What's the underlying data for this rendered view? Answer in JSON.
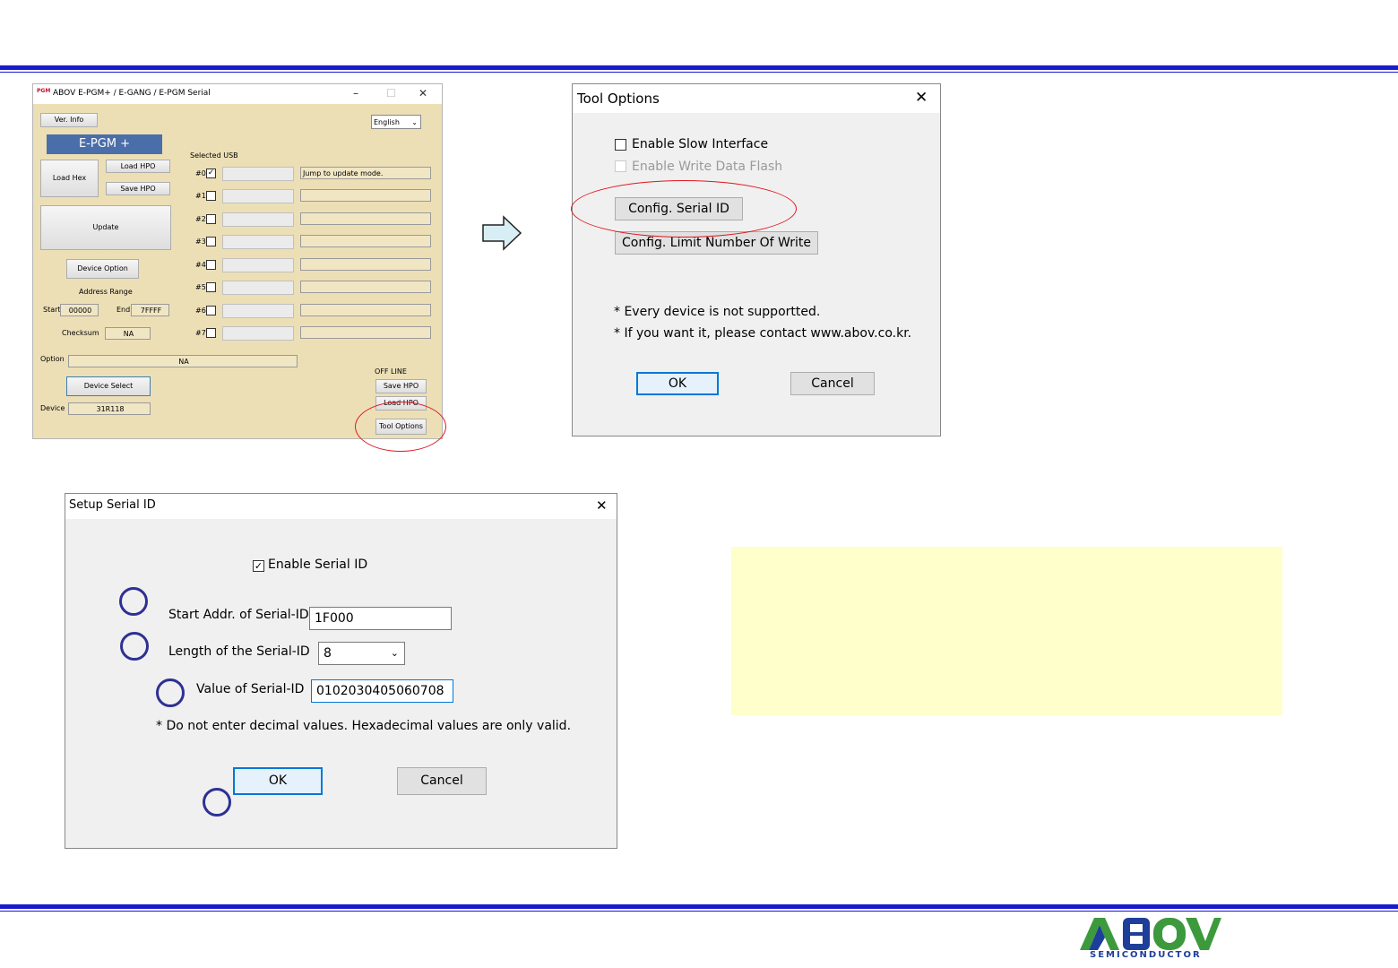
{
  "epgm_window": {
    "title": "ABOV E-PGM+ / E-GANG / E-PGM Serial",
    "ver_info": "Ver. Info",
    "language": "English",
    "brand": "E-PGM +",
    "load_hex": "Load Hex",
    "load_hpo": "Load HPO",
    "save_hpo": "Save HPO",
    "update": "Update",
    "device_option": "Device Option",
    "address_range": "Address Range",
    "start_label": "Start",
    "start_value": "00000",
    "end_label": "End",
    "end_value": "7FFFF",
    "checksum_label": "Checksum",
    "checksum_value": "NA",
    "option_label": "Option",
    "option_value": "NA",
    "device_select": "Device Select",
    "device_label": "Device",
    "device_value": "31R118",
    "selected_usb": "Selected USB",
    "usb": [
      {
        "label": "#0",
        "checked": true,
        "status": "Jump to update mode."
      },
      {
        "label": "#1",
        "checked": false,
        "status": ""
      },
      {
        "label": "#2",
        "checked": false,
        "status": ""
      },
      {
        "label": "#3",
        "checked": false,
        "status": ""
      },
      {
        "label": "#4",
        "checked": false,
        "status": ""
      },
      {
        "label": "#5",
        "checked": false,
        "status": ""
      },
      {
        "label": "#6",
        "checked": false,
        "status": ""
      },
      {
        "label": "#7",
        "checked": false,
        "status": ""
      }
    ],
    "off_line": "OFF LINE",
    "offline_save_hpo": "Save HPO",
    "offline_load_hpo": "Load HPO",
    "tool_options": "Tool Options"
  },
  "tool_options_dialog": {
    "title": "Tool Options",
    "enable_slow_interface": "Enable Slow Interface",
    "enable_write_data_flash": "Enable Write Data Flash",
    "config_serial_id": "Config. Serial ID",
    "config_limit": "Config. Limit Number Of Write",
    "note1": "* Every device is not supportted.",
    "note2": "* If you want it, please contact www.abov.co.kr.",
    "ok": "OK",
    "cancel": "Cancel"
  },
  "serial_id_dialog": {
    "title": "Setup Serial ID",
    "enable_serial_id": "Enable Serial ID",
    "enable_checked": true,
    "start_addr_label": "Start Addr. of Serial-ID",
    "start_addr_value": "1F000",
    "length_label": "Length of the Serial-ID",
    "length_value": "8",
    "value_label": "Value of  Serial-ID",
    "value_value": "0102030405060708",
    "note": "* Do not enter decimal values. Hexadecimal values are only valid.",
    "ok": "OK",
    "cancel": "Cancel"
  },
  "logo": {
    "brand": "ABOV",
    "sub": "SEMICONDUCTOR"
  },
  "colors": {
    "accent_blue": "#1a1acd",
    "highlight_red": "#e0161f",
    "step_circle": "#2e3192",
    "note_yellow": "#ffffcc",
    "logo_green": "#3c9a3c",
    "logo_blue": "#1e3f99"
  }
}
